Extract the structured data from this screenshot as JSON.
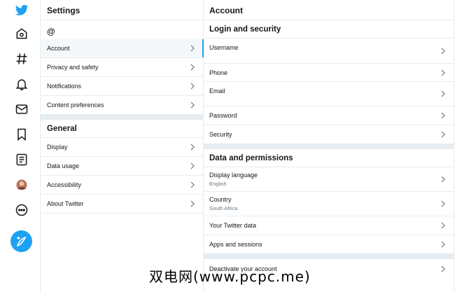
{
  "settings": {
    "title": "Settings",
    "handle": "@",
    "items": [
      {
        "label": "Account"
      },
      {
        "label": "Privacy and safety"
      },
      {
        "label": "Notifications"
      },
      {
        "label": "Content preferences"
      }
    ],
    "general_title": "General",
    "general_items": [
      {
        "label": "Display"
      },
      {
        "label": "Data usage"
      },
      {
        "label": "Accessibility"
      },
      {
        "label": "About Twitter"
      }
    ]
  },
  "account": {
    "title": "Account",
    "login_title": "Login and security",
    "login_items": [
      {
        "label": "Username"
      },
      {
        "label": "Phone"
      },
      {
        "label": "Email"
      },
      {
        "label": "Password"
      },
      {
        "label": "Security"
      }
    ],
    "data_title": "Data and permissions",
    "data_items": [
      {
        "label": "Display language",
        "value": "English"
      },
      {
        "label": "Country",
        "value": "South Africa"
      },
      {
        "label": "Your Twitter data"
      },
      {
        "label": "Apps and sessions"
      }
    ],
    "deactivate": "Deactivate your account"
  },
  "watermark": "双电网(www.pcpc.me)",
  "colors": {
    "accent": "#1da1f2",
    "border": "#e6ecf0",
    "muted": "#657786"
  }
}
